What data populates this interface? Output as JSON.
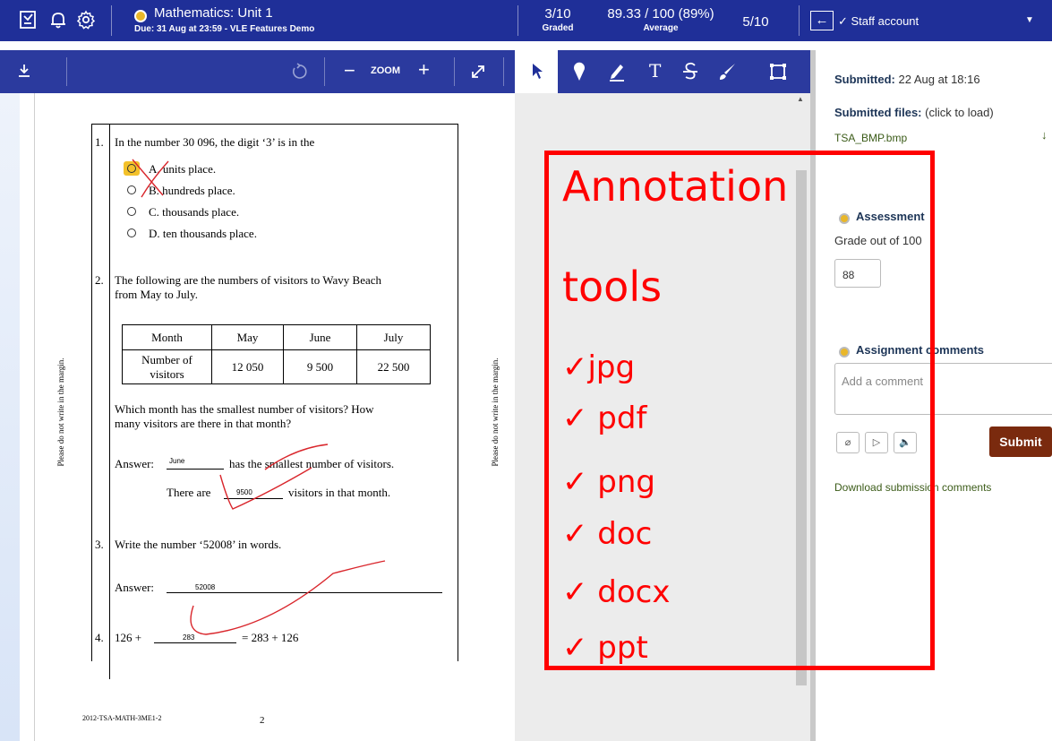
{
  "header": {
    "course_title": "Mathematics: Unit 1",
    "course_subtitle": "Due: 31 Aug at 23:59 - VLE Features Demo",
    "graded_value": "3/10",
    "graded_label": "Graded",
    "average_value": "89.33 / 100 (89%)",
    "average_label": "Average",
    "position": "5/10",
    "back_arrow": "←",
    "user_label": "✓ Staff account",
    "user_caret": "▼",
    "accent_color": "#1f2f98"
  },
  "toolbar": {
    "zoom_label": "ZOOM",
    "zoom_minus": "−",
    "zoom_plus": "+",
    "tools": [
      "download-icon",
      "rotate-icon",
      "zoom-out-icon",
      "zoom-in-icon",
      "fullscreen-icon",
      "select-icon",
      "pin-icon",
      "pen-icon",
      "text-icon",
      "strikethrough-icon",
      "brush-icon",
      "rectangle-icon"
    ],
    "text_tool": "T"
  },
  "document": {
    "margin_note": "Please do not write in the margin.",
    "q1": {
      "num": "1.",
      "text": "In the number 30 096, the digit ‘3’ is in the",
      "options": [
        "A.   units place.",
        "B.   hundreds place.",
        "C.   thousands place.",
        "D.   ten thousands place."
      ]
    },
    "q2": {
      "num": "2.",
      "text_line1": "The following are the numbers of visitors to Wavy Beach",
      "text_line2": "from May to July.",
      "table_header": [
        "Month",
        "May",
        "June",
        "July"
      ],
      "table_row_label_1": "Number of",
      "table_row_label_2": "visitors",
      "table_values": [
        "12 050",
        "9 500",
        "22 500"
      ],
      "question_line1": "Which month has the smallest number of visitors? How",
      "question_line2": "many visitors are there in that month?",
      "answer_prefix": "Answer:",
      "answer_month": "June",
      "answer_mid": "has the smallest number of visitors.",
      "there_are": "There are",
      "answer_count": "9500",
      "answer_end": "visitors in that month."
    },
    "q3": {
      "num": "3.",
      "text": "Write the number ‘52008’ in words.",
      "answer_prefix": "Answer:",
      "answer": "52008"
    },
    "q4": {
      "num": "4.",
      "left": "126 +",
      "answer": "283",
      "right": "= 283 + 126"
    },
    "footer_code": "2012-TSA-MATH-3ME1-2",
    "page_number": "2"
  },
  "panel": {
    "submitted_label": "Submitted:",
    "submitted_value": "22 Aug at 18:16",
    "files_label": "Submitted files:",
    "files_hint": "(click to load)",
    "file_name": "TSA_BMP.bmp",
    "file_download": "↓",
    "assessment_title": "Assessment",
    "grade_out_of": "Grade out of 100",
    "grade_value": "88",
    "comments_title": "Assignment comments",
    "comment_placeholder": "Add a comment",
    "attach_icon": "⌀",
    "media_icon": "▷",
    "audio_icon": "🔈",
    "submit_label": "Submit",
    "submit_color": "#7a2a0e",
    "download_comments": "Download submission comments"
  },
  "overlay": {
    "title_line1": "Annotation",
    "title_line2": "tools",
    "items": [
      "✓jpg",
      "✓ pdf",
      "✓ png",
      "✓ doc",
      "✓ docx",
      "✓ ppt"
    ],
    "color": "#ff0000"
  }
}
